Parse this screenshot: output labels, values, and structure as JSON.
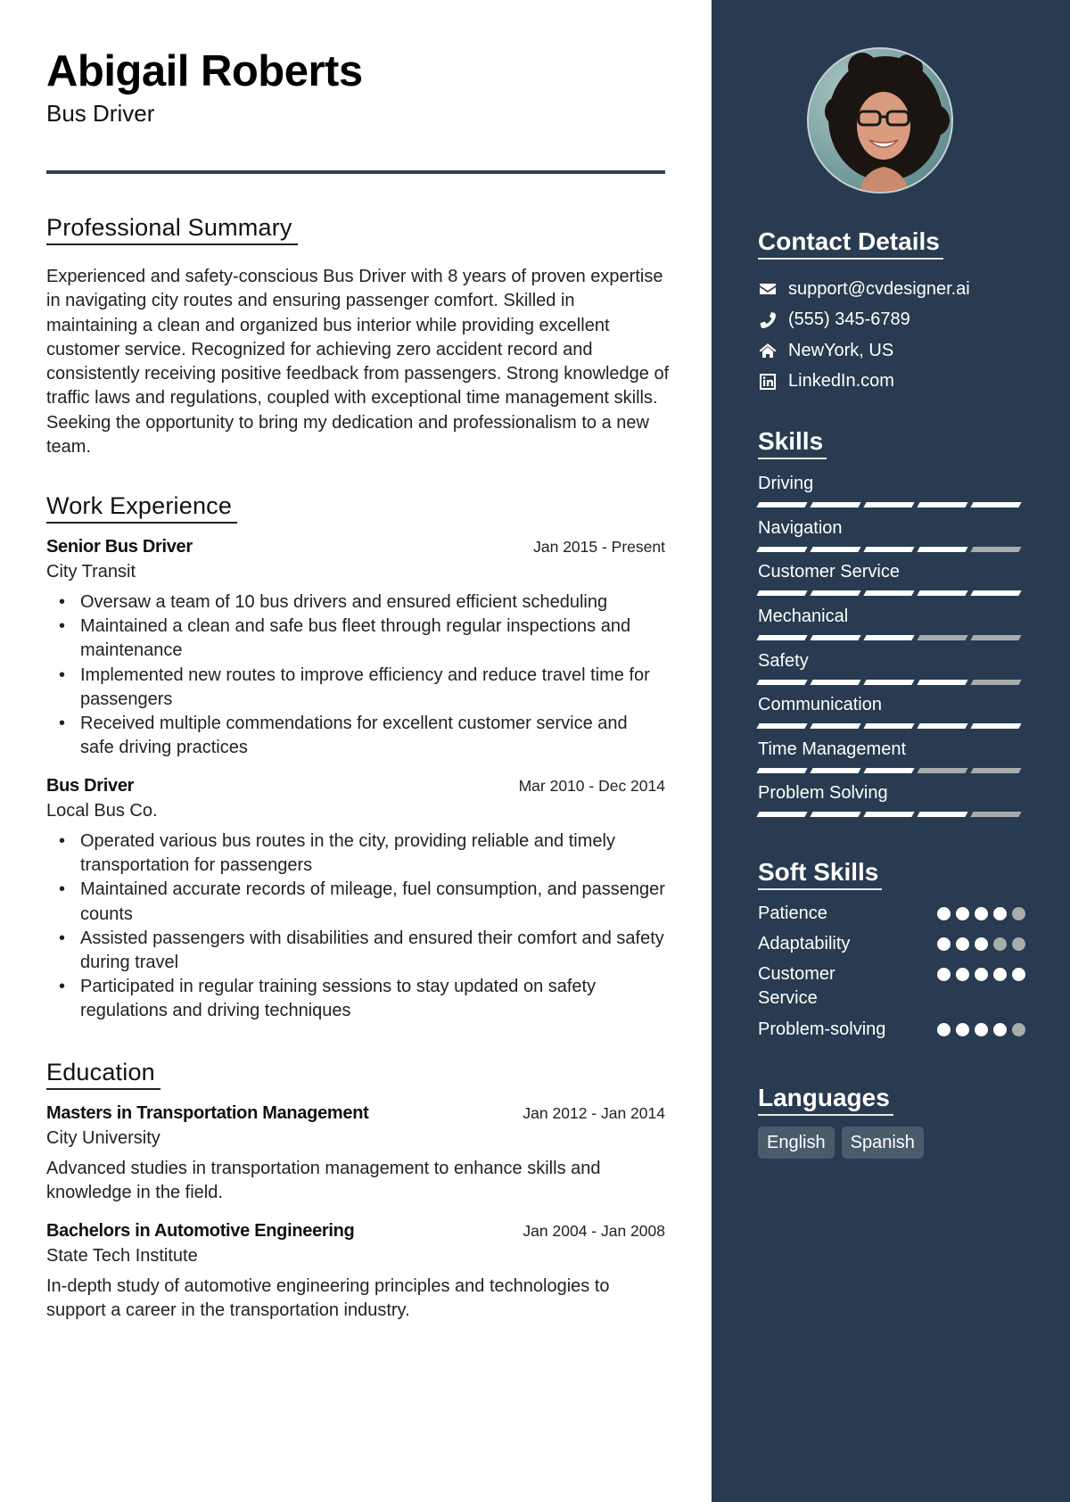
{
  "header": {
    "name": "Abigail Roberts",
    "title": "Bus Driver"
  },
  "summary": {
    "heading": "Professional Summary",
    "text": "Experienced and safety-conscious Bus Driver with 8 years of proven expertise in navigating city routes and ensuring passenger comfort. Skilled in maintaining a clean and organized bus interior while providing excellent customer service. Recognized for achieving zero accident record and consistently receiving positive feedback from passengers. Strong knowledge of traffic laws and regulations, coupled with exceptional time management skills. Seeking the opportunity to bring my dedication and professionalism to a new team."
  },
  "experience": {
    "heading": "Work Experience",
    "jobs": [
      {
        "title": "Senior Bus Driver",
        "dates": "Jan 2015 - Present",
        "company": "City Transit",
        "bullets": [
          "Oversaw a team of 10 bus drivers and ensured efficient scheduling",
          "Maintained a clean and safe bus fleet through regular inspections and maintenance",
          "Implemented new routes to improve efficiency and reduce travel time for passengers",
          "Received multiple commendations for excellent customer service and safe driving practices"
        ]
      },
      {
        "title": "Bus Driver",
        "dates": "Mar 2010 - Dec 2014",
        "company": "Local Bus Co.",
        "bullets": [
          "Operated various bus routes in the city, providing reliable and timely transportation for passengers",
          "Maintained accurate records of mileage, fuel consumption, and passenger counts",
          "Assisted passengers with disabilities and ensured their comfort and safety during travel",
          "Participated in regular training sessions to stay updated on safety regulations and driving techniques"
        ]
      }
    ]
  },
  "education": {
    "heading": "Education",
    "items": [
      {
        "degree": "Masters in Transportation Management",
        "dates": "Jan 2012 - Jan 2014",
        "school": "City University",
        "description": "Advanced studies in transportation management to enhance skills and knowledge in the field."
      },
      {
        "degree": "Bachelors in Automotive Engineering",
        "dates": "Jan 2004 - Jan 2008",
        "school": "State Tech Institute",
        "description": "In-depth study of automotive engineering principles and technologies to support a career in the transportation industry."
      }
    ]
  },
  "sidebar": {
    "photo_alt": "profile-photo",
    "contact": {
      "heading": "Contact Details",
      "items": [
        {
          "icon": "envelope-icon",
          "text": "support@cvdesigner.ai"
        },
        {
          "icon": "phone-icon",
          "text": "(555) 345-6789"
        },
        {
          "icon": "home-icon",
          "text": "NewYork, US"
        },
        {
          "icon": "linkedin-icon",
          "text": "LinkedIn.com"
        }
      ]
    },
    "skills": {
      "heading": "Skills",
      "max": 5,
      "items": [
        {
          "label": "Driving",
          "level": 5
        },
        {
          "label": "Navigation",
          "level": 4
        },
        {
          "label": "Customer Service",
          "level": 5
        },
        {
          "label": "Mechanical",
          "level": 3
        },
        {
          "label": "Safety",
          "level": 4
        },
        {
          "label": "Communication",
          "level": 5
        },
        {
          "label": "Time Management",
          "level": 3
        },
        {
          "label": "Problem Solving",
          "level": 4
        }
      ]
    },
    "soft_skills": {
      "heading": "Soft Skills",
      "max": 5,
      "items": [
        {
          "label": "Patience",
          "level": 4
        },
        {
          "label": "Adaptability",
          "level": 3
        },
        {
          "label": "Customer Service",
          "level": 5
        },
        {
          "label": "Problem-solving",
          "level": 4
        }
      ]
    },
    "languages": {
      "heading": "Languages",
      "items": [
        "English",
        "Spanish"
      ]
    }
  },
  "colors": {
    "sidebar_bg": "#283b50",
    "accent": "#2c3e50",
    "rating_on": "#ffffff",
    "rating_off": "#a9abad",
    "chip_bg": "#4a5b6c"
  }
}
